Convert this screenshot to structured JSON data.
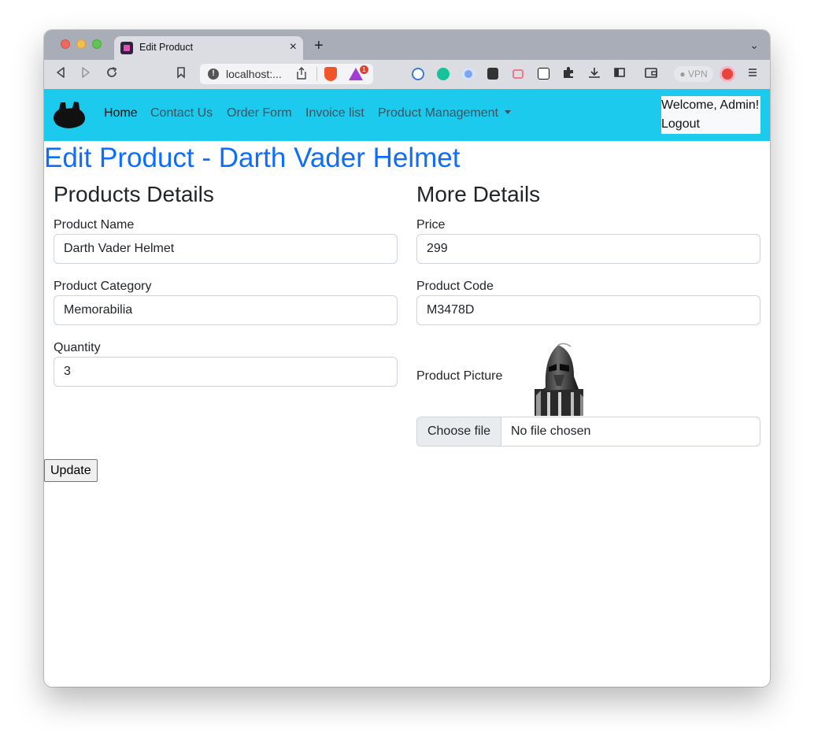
{
  "browser": {
    "tab_title": "Edit Product",
    "tab_close": "×",
    "new_tab": "+",
    "tab_menu": "⌄",
    "url": "localhost:...",
    "vpn_label": "● VPN",
    "extension_badge": "1"
  },
  "navbar": {
    "links": [
      "Home",
      "Contact Us",
      "Order Form",
      "Invoice list",
      "Product Management"
    ],
    "welcome": "Welcome, Admin!",
    "logout": "Logout"
  },
  "page": {
    "title": "Edit Product - Darth Vader Helmet",
    "left_heading": "Products Details",
    "right_heading": "More Details",
    "product_name_label": "Product Name",
    "product_name_value": "Darth Vader Helmet",
    "product_category_label": "Product Category",
    "product_category_value": "Memorabilia",
    "quantity_label": "Quantity",
    "quantity_value": "3",
    "price_label": "Price",
    "price_value": "299",
    "product_code_label": "Product Code",
    "product_code_value": "M3478D",
    "product_picture_label": "Product Picture",
    "choose_file": "Choose file",
    "file_status": "No file chosen",
    "update_button": "Update"
  },
  "colors": {
    "navbar_bg": "#1ccaee",
    "title_blue": "#0d6efd"
  }
}
